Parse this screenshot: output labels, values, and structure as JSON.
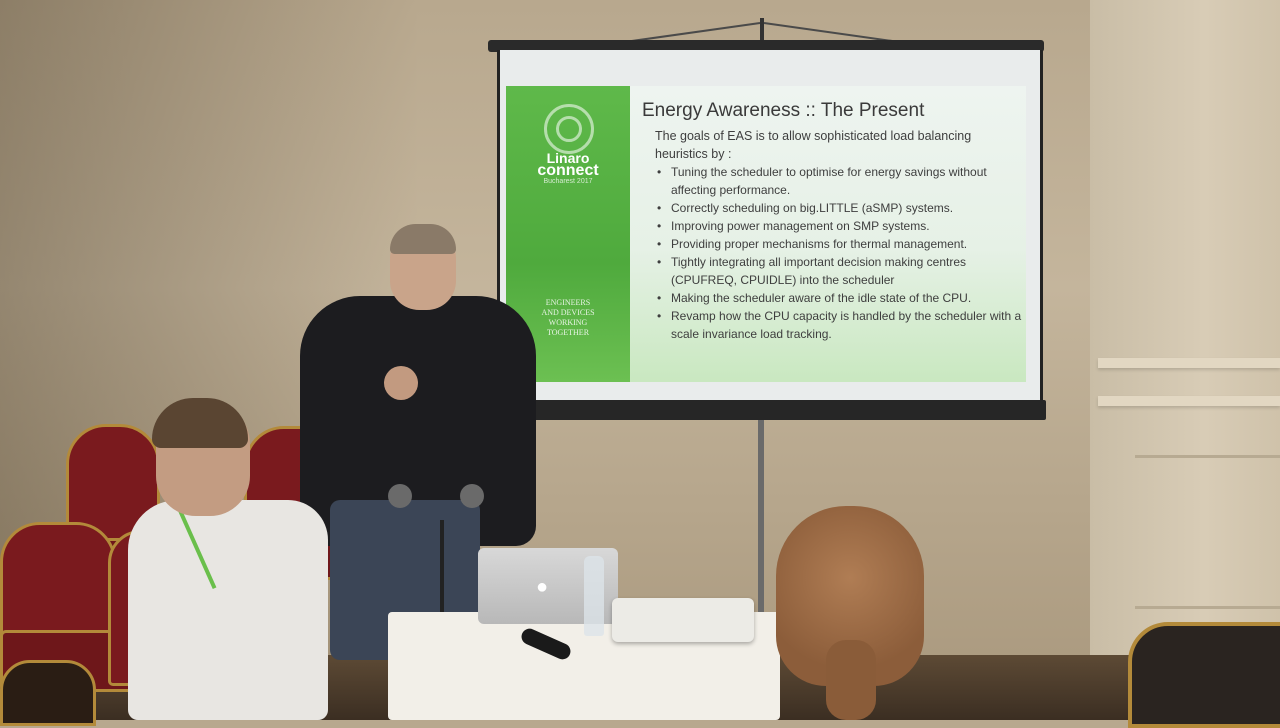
{
  "slide": {
    "logo": {
      "brand": "Linaro",
      "product": "connect",
      "date": "Bucharest 2017"
    },
    "tagline": [
      "ENGINEERS",
      "AND DEVICES",
      "WORKING",
      "TOGETHER"
    ],
    "title": "Energy Awareness :: The Present",
    "intro": "The goals of EAS is to allow sophisticated load balancing heuristics by :",
    "bullets": [
      "Tuning the scheduler to optimise for energy savings without affecting performance.",
      "Correctly scheduling on big.LITTLE (aSMP) systems.",
      "Improving power management on SMP systems.",
      "Providing proper mechanisms for thermal management.",
      "Tightly integrating all important decision making centres (CPUFREQ, CPUIDLE) into the scheduler",
      "Making the scheduler aware of the idle state of the CPU.",
      "Revamp how the CPU capacity is handled by the scheduler with a scale invariance load tracking."
    ]
  },
  "icons": {
    "logo": "linaro-logo-icon",
    "laptop": "apple-logo-icon"
  },
  "colors": {
    "slide_green": "#5fb94a",
    "chair_red": "#7a1a1e",
    "chair_gold": "#b38a3a"
  }
}
